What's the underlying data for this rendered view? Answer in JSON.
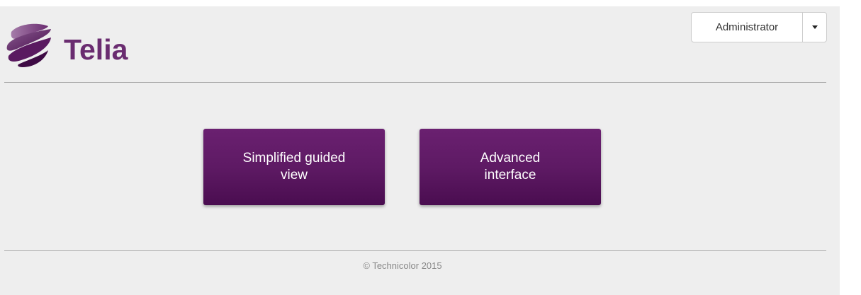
{
  "header": {
    "logo_text": "Telia",
    "user_menu": {
      "label": "Administrator"
    }
  },
  "main": {
    "buttons": [
      {
        "label": "Simplified guided\nview"
      },
      {
        "label": "Advanced\ninterface"
      }
    ]
  },
  "footer": {
    "copyright": "© Technicolor 2015"
  },
  "colors": {
    "brand_purple": "#6a2c70",
    "button_purple": "#5e1a64",
    "background": "#eeeeee"
  }
}
